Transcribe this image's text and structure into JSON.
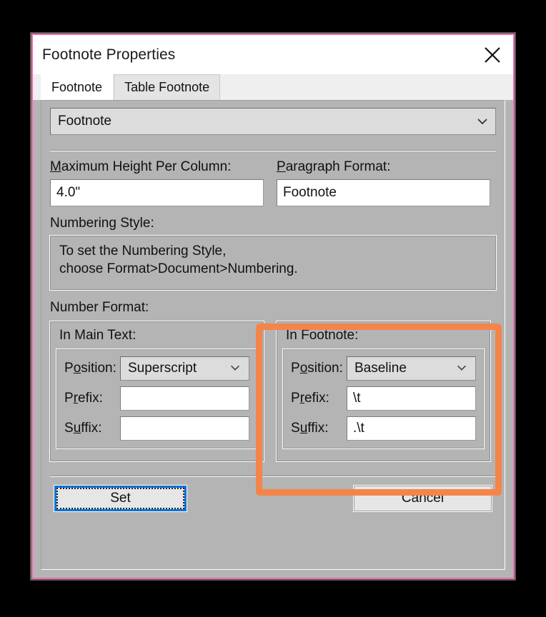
{
  "window": {
    "title": "Footnote Properties",
    "close_icon": "close-icon",
    "border_color": "#f06ab0"
  },
  "tabs": [
    {
      "label": "Footnote",
      "active": true
    },
    {
      "label": "Table Footnote",
      "active": false
    }
  ],
  "type_combo": {
    "value": "Footnote",
    "chevron_icon": "chevron-down-icon"
  },
  "fields": {
    "max_height": {
      "label": "Maximum Height Per Column:",
      "accel": "M",
      "value": "4.0\""
    },
    "paragraph_format": {
      "label": "Paragraph Format:",
      "accel": "P",
      "value": "Footnote"
    }
  },
  "numbering_style": {
    "label": "Numbering Style:",
    "line1": "To set the Numbering Style,",
    "line2": "choose Format>Document>Numbering."
  },
  "number_format": {
    "label": "Number Format:",
    "main_text": {
      "title": "In Main Text:",
      "position_label": "Position:",
      "position_value": "Superscript",
      "prefix_label": "Prefix:",
      "prefix_value": "",
      "suffix_label": "Suffix:",
      "suffix_value": ""
    },
    "footnote": {
      "title": "In Footnote:",
      "position_label": "Position:",
      "position_value": "Baseline",
      "prefix_label": "Prefix:",
      "prefix_value": "\\t",
      "suffix_label": "Suffix:",
      "suffix_value": ".\\t"
    }
  },
  "buttons": {
    "set": "Set",
    "cancel": "Cancel"
  },
  "annotation": {
    "highlight_color": "#f4854a",
    "target": "in-footnote-group"
  }
}
